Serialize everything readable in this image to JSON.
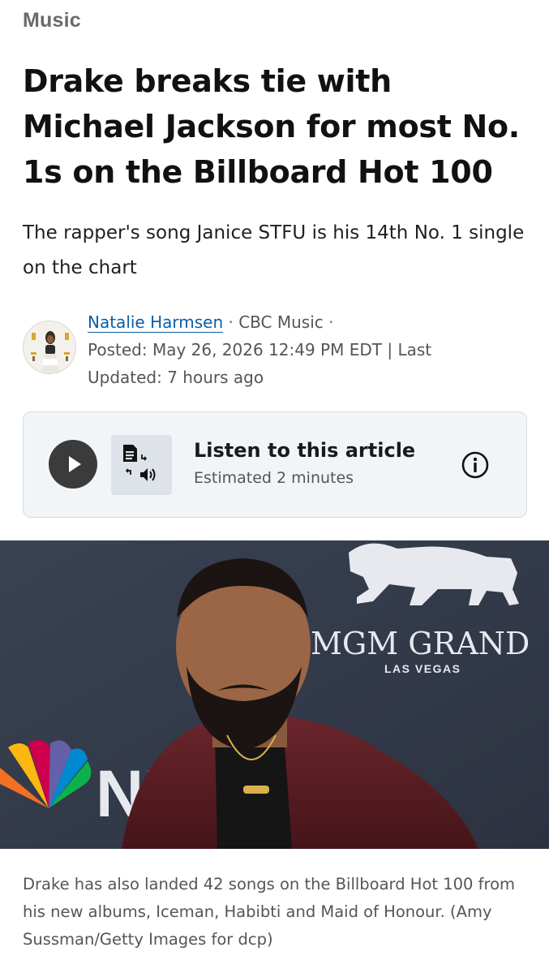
{
  "article": {
    "section": "Music",
    "headline": "Drake breaks tie with Michael Jackson for most No. 1s on the Billboard Hot 100",
    "dek": "The rapper's song Janice STFU is his 14th No. 1 single on the chart"
  },
  "byline": {
    "author": "Natalie Harmsen",
    "separator": "·",
    "outlet": "CBC Music",
    "posted": "Posted: May 26, 2026 12:49 PM EDT | Last Updated: 7 hours ago"
  },
  "listen": {
    "title": "Listen to this article",
    "subtitle": "Estimated 2 minutes",
    "play_icon": "play-icon",
    "tts_icon": "text-to-speech-icon",
    "info_icon": "info-icon"
  },
  "photo": {
    "backdrop_brand": "MGM GRAND",
    "backdrop_location": "LAS VEGAS",
    "backdrop_network": "NB",
    "caption": "Drake has also landed 42 songs on the Billboard Hot 100 from his new albums, Iceman, Habibti and Maid of Honour. (Amy Sussman/Getty Images for dcp)"
  },
  "colors": {
    "link": "#0b5ea8",
    "card_bg": "#f2f5f8",
    "play_button": "#3b3b3b",
    "backdrop": "#353d4d",
    "jacket": "#5a1f24"
  }
}
